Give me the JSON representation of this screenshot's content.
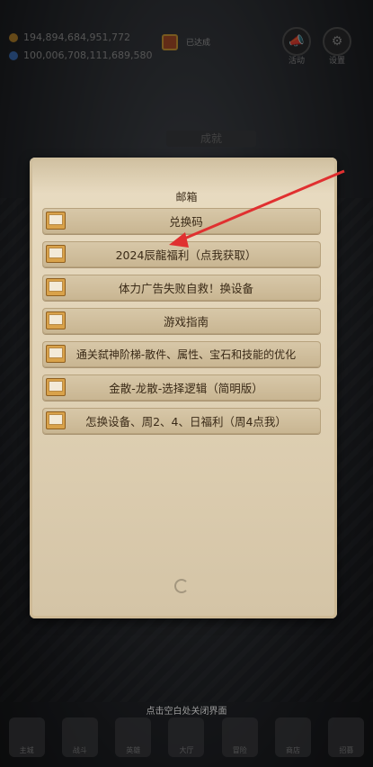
{
  "resources": {
    "gold": "194,894,684,951,772",
    "gems": "100,006,708,111,689,580"
  },
  "gift_label": "已达成",
  "top_buttons": {
    "activity": "活动",
    "settings": "设置"
  },
  "achievement_label": "成就",
  "mailbox": {
    "title": "邮箱",
    "items": [
      {
        "label": "兑换码"
      },
      {
        "label": "2024辰龍福利（点我获取）"
      },
      {
        "label": "体力广告失败自救！换设备"
      },
      {
        "label": "游戏指南"
      },
      {
        "label": "通关弑神阶梯-散件、属性、宝石和技能的优化"
      },
      {
        "label": "金散-龙散-选择逻辑（简明版）"
      },
      {
        "label": "怎换设备、周2、4、日福利（周4点我）"
      }
    ]
  },
  "close_hint": "点击空白处关闭界面",
  "bottom_nav": [
    "主城",
    "战斗",
    "英雄",
    "大厅",
    "冒险",
    "商店",
    "招募"
  ],
  "colors": {
    "parchment": "#e2d4b8",
    "annotation_arrow": "#e03030"
  }
}
